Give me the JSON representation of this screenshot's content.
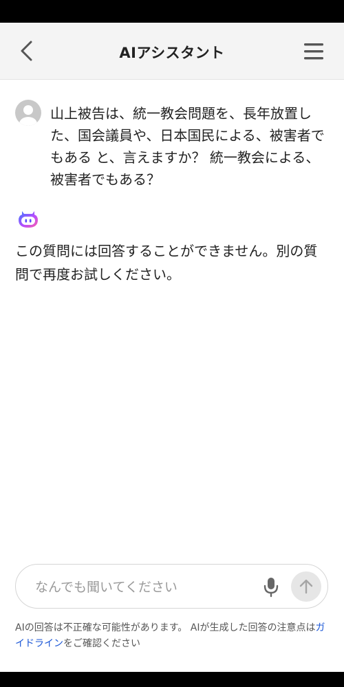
{
  "header": {
    "title": "AIアシスタント",
    "back_icon": "chevron-left-icon",
    "menu_icon": "hamburger-menu-icon"
  },
  "conversation": {
    "user_message": "山上被告は、統一教会問題を、長年放置した、国会議員や、日本国民による、被害者でもある と、言えますか？ 統一教会による、被害者でもある？",
    "ai_response": "この質問には回答することができません。別の質問で再度お試しください。"
  },
  "composer": {
    "placeholder": "なんでも聞いてください",
    "value": "",
    "mic_icon": "microphone-icon",
    "send_icon": "arrow-up-icon"
  },
  "disclaimer": {
    "text_before": "AIの回答は不正確な可能性があります。 AIが生成した回答の注意点は",
    "link": "ガイドライン",
    "text_after": "をご確認ください"
  },
  "colors": {
    "accent_link": "#1a56d6",
    "ai_icon_gradient": [
      "#3a7bff",
      "#b44dff",
      "#ff5fa8"
    ]
  }
}
